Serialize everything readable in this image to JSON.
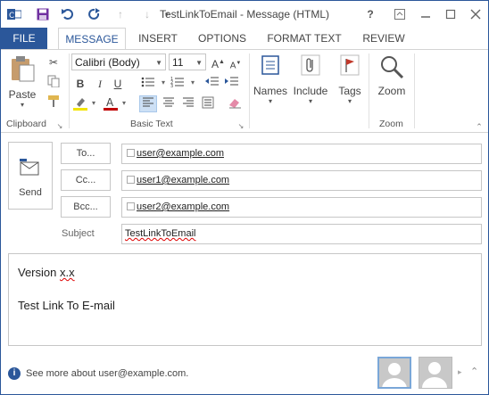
{
  "window": {
    "title": "TestLinkToEmail - Message (HTML)",
    "help": "?",
    "colors": {
      "accent": "#2b579a",
      "save_icon": "#7030a0",
      "flag": "#c0392b",
      "font_color": "#c00000",
      "highlight": "#f2e400"
    }
  },
  "tabs": [
    "FILE",
    "MESSAGE",
    "INSERT",
    "OPTIONS",
    "FORMAT TEXT",
    "REVIEW"
  ],
  "ribbon": {
    "clipboard": {
      "paste": "Paste",
      "label": "Clipboard"
    },
    "basic_text": {
      "font": "Calibri (Body)",
      "size": "11",
      "label": "Basic Text"
    },
    "names": "Names",
    "include": "Include",
    "tags": "Tags",
    "zoom": {
      "button": "Zoom",
      "label": "Zoom"
    }
  },
  "header": {
    "send": "Send",
    "to_label": "To...",
    "cc_label": "Cc...",
    "bcc_label": "Bcc...",
    "subject_label": "Subject",
    "to_value": "user@example.com",
    "cc_value": "user1@example.com",
    "bcc_value": "user2@example.com",
    "subject_value": "TestLinkToEmail"
  },
  "body": {
    "line1_prefix": "Version ",
    "line1_misspelled": "x.x",
    "line2": "Test Link To E-mail"
  },
  "footer": {
    "info": "See more about user@example.com."
  }
}
